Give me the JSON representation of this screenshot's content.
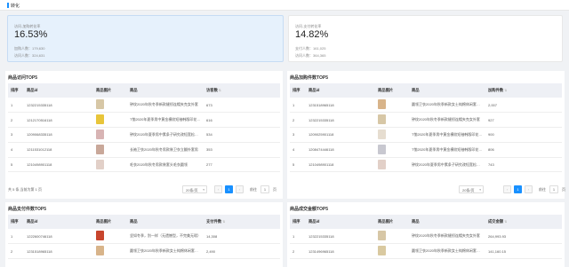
{
  "header": {
    "title": "转化"
  },
  "kpis": [
    {
      "label": "访问-加购转化率",
      "value": "16.53%",
      "sub1": "加购人数：179,630",
      "sub2": "访问人数：324,631"
    },
    {
      "label": "访问-支付转化率",
      "value": "14.82%",
      "sub1": "支付人数：161,025",
      "sub2": "访问人数：364,365"
    }
  ],
  "panels": [
    {
      "title": "商品访问TOP5",
      "columns": [
        "排序",
        "商品id",
        "商品图片",
        "商品",
        "访客数"
      ],
      "rows": [
        {
          "rank": "1",
          "id": "1232215335118",
          "thumb": "#d7c7a6",
          "name": "钟纹2020年秋冬季新款缝纫连帽夹克女外套",
          "value": "673"
        },
        {
          "rank": "2",
          "id": "1212170516118",
          "thumb": "#e8c53a",
          "name": "T恤2020年夏季男中黄金横纹短袖韩版印花宽松上衣",
          "value": "616"
        },
        {
          "rank": "3",
          "id": "1209068335118",
          "thumb": "#d8b4b4",
          "name": "钟纹2020年夏季男中素条子研究改短宽松上衣",
          "value": "534"
        },
        {
          "rank": "4",
          "id": "1211531012118",
          "thumb": "#c9a89a",
          "name": "长袖卫衣2020年秋冬男款装卫衣立翻外套男",
          "value": "353"
        },
        {
          "rank": "5",
          "id": "1210498901118",
          "thumb": "#e2d0c8",
          "name": "毛衣2020年秋冬男款装套头毛衣圆领",
          "value": "277"
        }
      ],
      "pager": {
        "total": "共 5 条,当前为第 1 页",
        "size": "20条/页",
        "page": "1",
        "goto": "前往",
        "goto_value": "1",
        "goto_unit": "页"
      }
    },
    {
      "title": "商品加购件数TOP5",
      "columns": [
        "排序",
        "商品id",
        "商品图片",
        "商品",
        "加购件数"
      ],
      "rows": [
        {
          "rank": "1",
          "id": "1231518965118",
          "thumb": "#d8b48a",
          "name": "圆领卫衣2020年秋季新款女士纯棉休闲套头男",
          "value": "2,007"
        },
        {
          "rank": "2",
          "id": "1232215335118",
          "thumb": "#d7c7a6",
          "name": "钟纹2020年秋冬季新款缝纫连帽夹克女外套",
          "value": "927"
        },
        {
          "rank": "3",
          "id": "1209025901118",
          "thumb": "#e6ddd0",
          "name": "T恤2020年夏季男中黄金横纹短袖韩版印花宽松上衣",
          "value": "900"
        },
        {
          "rank": "4",
          "id": "1208474446118",
          "thumb": "#c8c8d0",
          "name": "T恤2020年夏季男中黄金横纹短袖韩版印花宽松上衣",
          "value": "806"
        },
        {
          "rank": "5",
          "id": "1210498901118",
          "thumb": "#e2d0c8",
          "name": "钟纹2020年夏季男中素条子研究改短宽松上衣",
          "value": "743"
        }
      ],
      "pager": {
        "total": "",
        "size": "20条/页",
        "page": "1",
        "goto": "前往",
        "goto_value": "1",
        "goto_unit": "页"
      }
    },
    {
      "title": "商品支付件数TOP5",
      "columns": [
        "排序",
        "商品id",
        "商品图片",
        "商品",
        "支付件数"
      ],
      "rows": [
        {
          "rank": "1",
          "id": "1222600746118",
          "thumb": "#c8452d",
          "name": "坚如冬季，别一样（无遗憾型，不完美无瑕）",
          "value": "14,308"
        },
        {
          "rank": "2",
          "id": "1231518965118",
          "thumb": "#d8b48a",
          "name": "圆领卫衣2020年秋季新款女士纯棉休闲套头男",
          "value": "2,490"
        }
      ]
    },
    {
      "title": "商品成交金额TOP5",
      "columns": [
        "排序",
        "商品id",
        "商品图片",
        "商品",
        "成交金额"
      ],
      "rows": [
        {
          "rank": "1",
          "id": "1232215335118",
          "thumb": "#d7c7a6",
          "name": "钟纹2020年秋冬季新款缝纫连帽夹克女外套",
          "value": "264,993.93"
        },
        {
          "rank": "2",
          "id": "1231496965118",
          "thumb": "#d9c9a0",
          "name": "圆领卫衣2020年秋季新款女士纯棉休闲套头男",
          "value": "141,160.15"
        }
      ]
    }
  ]
}
